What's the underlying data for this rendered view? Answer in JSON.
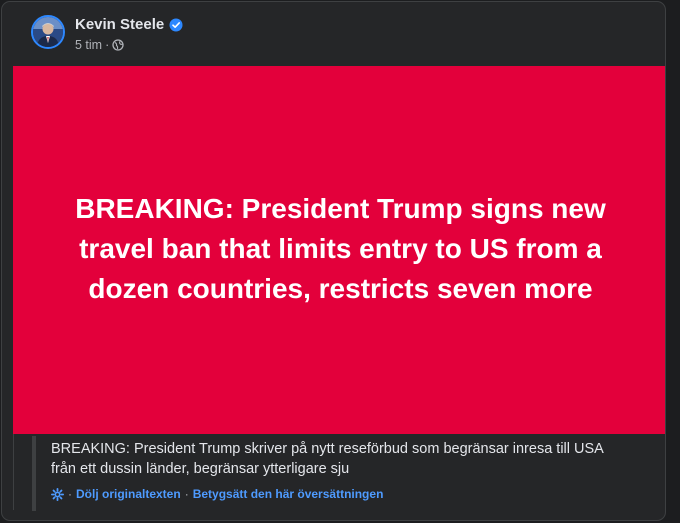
{
  "post": {
    "author": "Kevin Steele",
    "time": "5 tim",
    "meta_sep": "·",
    "banner_text": "BREAKING: President Trump signs new travel ban that limits entry to US from a dozen countries, restricts seven more",
    "translated_text": "BREAKING: President Trump skriver på nytt reseförbud som begränsar inresa till USA från ett dussin länder, begränsar ytterligare sju",
    "hide_original_label": "Dölj originaltexten",
    "rate_translation_label": "Betygsätt den här översättningen",
    "dot": "·"
  },
  "icons": {
    "verified": "verified-badge-icon",
    "audience": "globe-icon",
    "translation": "gear-icon"
  },
  "colors": {
    "banner": "#e3003b",
    "accent": "#2d88ff",
    "link": "#4e9bff"
  }
}
